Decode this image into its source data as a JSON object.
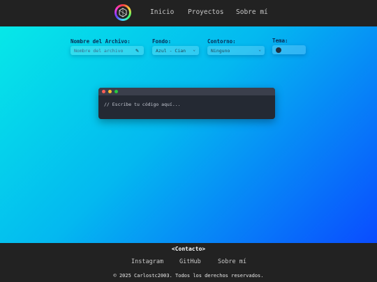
{
  "nav": {
    "links": [
      "Inicio",
      "Proyectos",
      "Sobre mí"
    ]
  },
  "form": {
    "filename": {
      "label": "Nombre del Archivo:",
      "placeholder": "Nombre del archivo"
    },
    "background": {
      "label": "Fondo:",
      "value": "Azul - Cian"
    },
    "outline": {
      "label": "Contorno:",
      "value": "Ninguno"
    },
    "theme": {
      "label": "Tema:"
    }
  },
  "editor": {
    "placeholder": "// Escribe tu código aquí...",
    "dot_colors": [
      "#ff5f56",
      "#ffbd2e",
      "#27c93f"
    ]
  },
  "footer": {
    "title": "<Contacto>",
    "links": [
      "Instagram",
      "GitHub",
      "Sobre mí"
    ],
    "copyright": "© 2025 Carlostc2003. Todos los derechos reservados."
  }
}
